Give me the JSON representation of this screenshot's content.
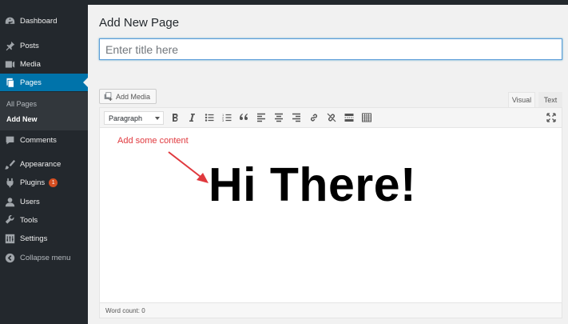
{
  "sidebar": {
    "items": [
      {
        "label": "Dashboard",
        "icon": "dashboard-icon"
      },
      {
        "label": "Posts",
        "icon": "pin-icon"
      },
      {
        "label": "Media",
        "icon": "media-icon"
      },
      {
        "label": "Pages",
        "icon": "pages-icon"
      },
      {
        "label": "Comments",
        "icon": "comment-icon"
      },
      {
        "label": "Appearance",
        "icon": "brush-icon"
      },
      {
        "label": "Plugins",
        "icon": "plugin-icon",
        "badge": "1"
      },
      {
        "label": "Users",
        "icon": "users-icon"
      },
      {
        "label": "Tools",
        "icon": "wrench-icon"
      },
      {
        "label": "Settings",
        "icon": "settings-icon"
      },
      {
        "label": "Collapse menu",
        "icon": "collapse-icon"
      }
    ],
    "submenu": [
      {
        "label": "All Pages"
      },
      {
        "label": "Add New"
      }
    ]
  },
  "main": {
    "title": "Add New Page",
    "title_placeholder": "Enter title here",
    "add_media_label": "Add Media",
    "tabs": [
      {
        "label": "Visual"
      },
      {
        "label": "Text"
      }
    ],
    "format_select_value": "Paragraph",
    "content_text": "Hi There!",
    "annotation": "Add some content",
    "word_count": "Word count: 0"
  },
  "colors": {
    "sidebar_bg": "#23282d",
    "active_blue": "#0073aa",
    "annotation_red": "#e0393e",
    "badge_orange": "#d54e21"
  }
}
